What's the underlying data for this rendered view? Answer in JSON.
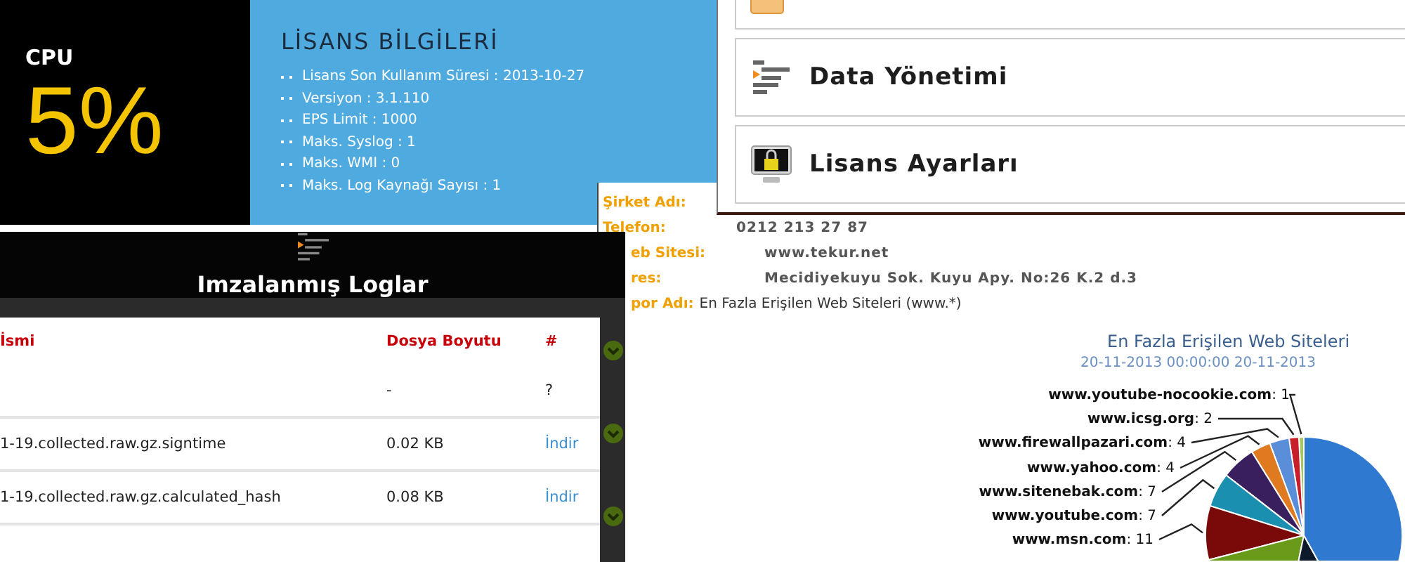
{
  "cpu_panel": {
    "label": "CPU",
    "value": "5%"
  },
  "license_panel": {
    "title": "LİSANS BİLGİLERİ",
    "items": [
      "Lisans Son Kullanım Süresi : 2013-10-27",
      "Versiyon : 3.1.110",
      "EPS Limit : 1000",
      "Maks. Syslog : 1",
      "Maks. WMI : 0",
      "Maks. Log Kaynağı Sayısı : 1"
    ]
  },
  "settings_menu": {
    "items": [
      {
        "kind": "partial"
      },
      {
        "kind": "data",
        "label": "Data Yönetimi"
      },
      {
        "kind": "license",
        "label": "Lisans Ayarları"
      }
    ]
  },
  "report": {
    "fields": [
      {
        "label": "Şirket Adı:"
      },
      {
        "label": "Telefon:",
        "value": "0212 213 27 87"
      },
      {
        "label": "eb Sitesi:",
        "value": "www.tekur.net"
      },
      {
        "label": "res:",
        "value": "Mecidiyekuyu Sok. Kuyu Apy. No:26 K.2 d.3"
      }
    ],
    "report_name": {
      "label": "por Adı:",
      "value": "En Fazla Erişilen Web Siteleri (www.*)"
    },
    "chart_data": {
      "type": "pie",
      "title": "En Fazla Erişilen Web Siteleri",
      "subtitle": "20-11-2013 00:00:00 20-11-2013",
      "categories": [
        "www.youtube-nocookie.com",
        "www.icsg.org",
        "www.firewallpazari.com",
        "www.yahoo.com",
        "www.sitenebak.com",
        "www.youtube.com",
        "www.msn.com",
        null,
        null,
        null
      ],
      "values": [
        1,
        2,
        4,
        4,
        7,
        7,
        11,
        22,
        14,
        52
      ],
      "data_labels": true,
      "value_labels": [
        ": 1",
        ": 2",
        ": 4",
        ": 4",
        ": 7",
        ": 7",
        ": 11",
        null,
        null,
        null
      ]
    }
  },
  "log_panel": {
    "title": "Imzalanmış Loglar",
    "columns": [
      "İsmi",
      "Dosya Boyutu",
      "#"
    ],
    "rows": [
      {
        "kind": "pending",
        "size": "-",
        "action": "?"
      },
      {
        "kind": "file",
        "name": "1-19.collected.raw.gz.signtime",
        "size": "0.02 KB",
        "action": "İndir"
      },
      {
        "kind": "file",
        "name": "1-19.collected.raw.gz.calculated_hash",
        "size": "0.08 KB",
        "action": "İndir"
      }
    ]
  }
}
